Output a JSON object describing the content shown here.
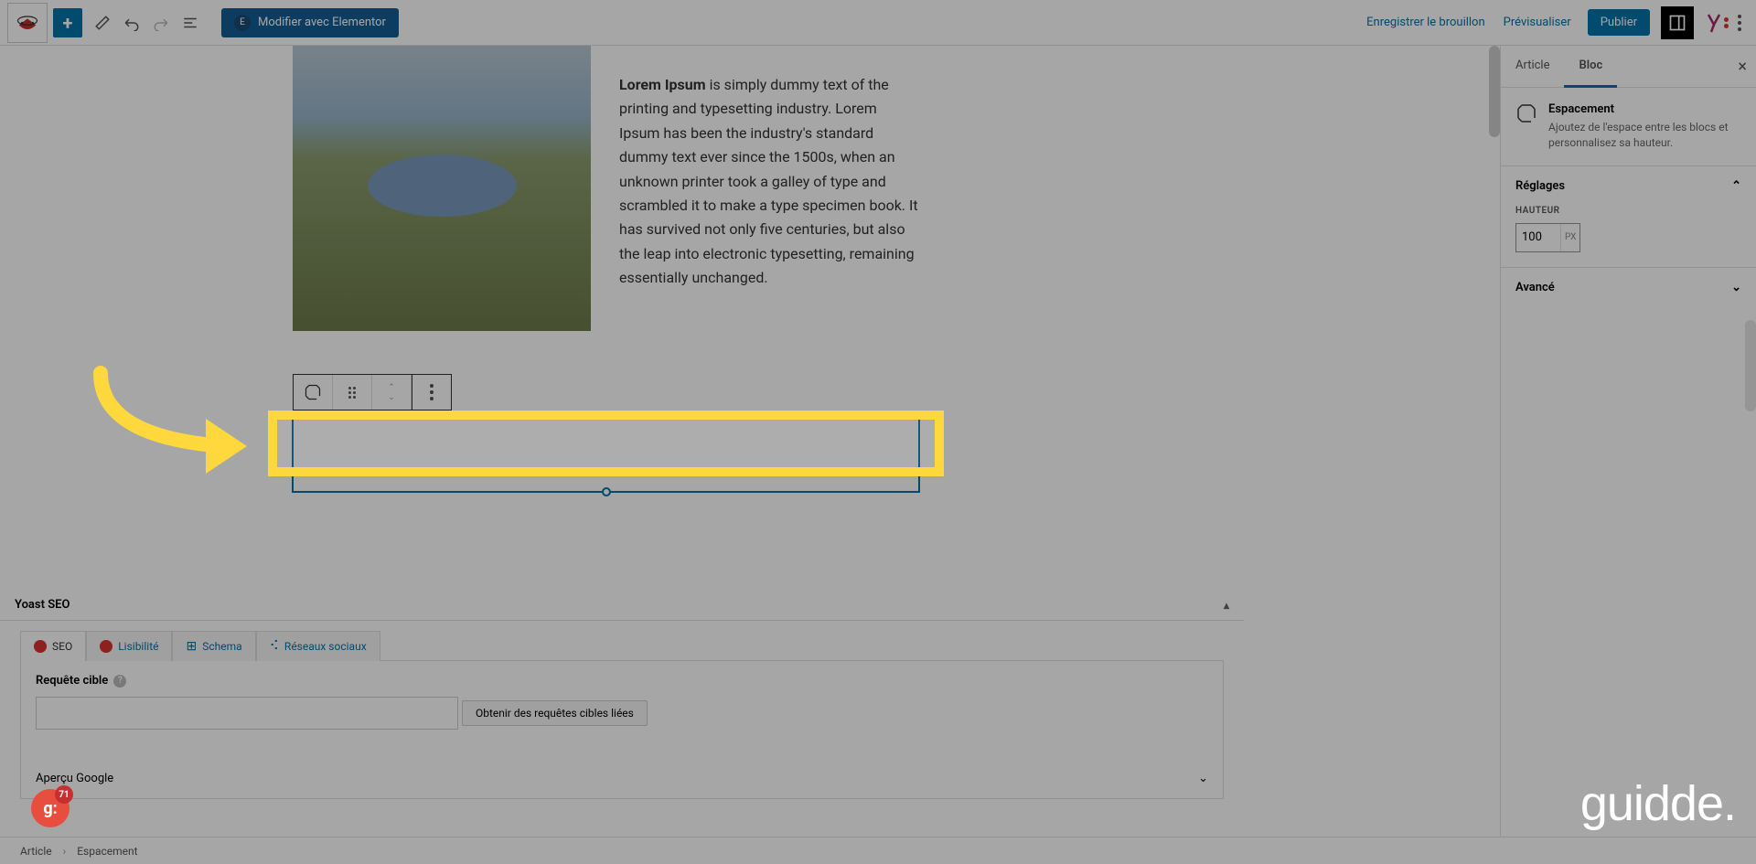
{
  "toolbar": {
    "elementor_label": "Modifier avec Elementor",
    "save_draft": "Enregistrer le brouillon",
    "preview": "Prévisualiser",
    "publish": "Publier"
  },
  "content": {
    "bold_lead": "Lorem Ipsum",
    "body": " is simply dummy text of the printing and typesetting industry. Lorem Ipsum has been the industry's standard dummy text ever since the 1500s, when an unknown printer took a galley of type and scrambled it to make a type specimen book. It has survived not only five centuries, but also the leap into electronic typesetting, remaining essentially unchanged."
  },
  "yoast": {
    "title": "Yoast SEO",
    "tabs": {
      "seo": "SEO",
      "readability": "Lisibilité",
      "schema": "Schema",
      "social": "Réseaux sociaux"
    },
    "focus_label": "Requête cible",
    "linked_btn": "Obtenir des requêtes cibles liées",
    "google_preview": "Aperçu Google"
  },
  "sidebar": {
    "tabs": {
      "article": "Article",
      "block": "Bloc"
    },
    "block_name": "Espacement",
    "block_desc": "Ajoutez de l'espace entre les blocs et personnalisez sa hauteur.",
    "settings_label": "Réglages",
    "height_label": "HAUTEUR",
    "height_value": "100",
    "height_unit": "PX",
    "advanced_label": "Avancé"
  },
  "breadcrumb": {
    "root": "Article",
    "current": "Espacement"
  },
  "badge": {
    "count": "71",
    "letter": "g:"
  },
  "brand": "guidde."
}
